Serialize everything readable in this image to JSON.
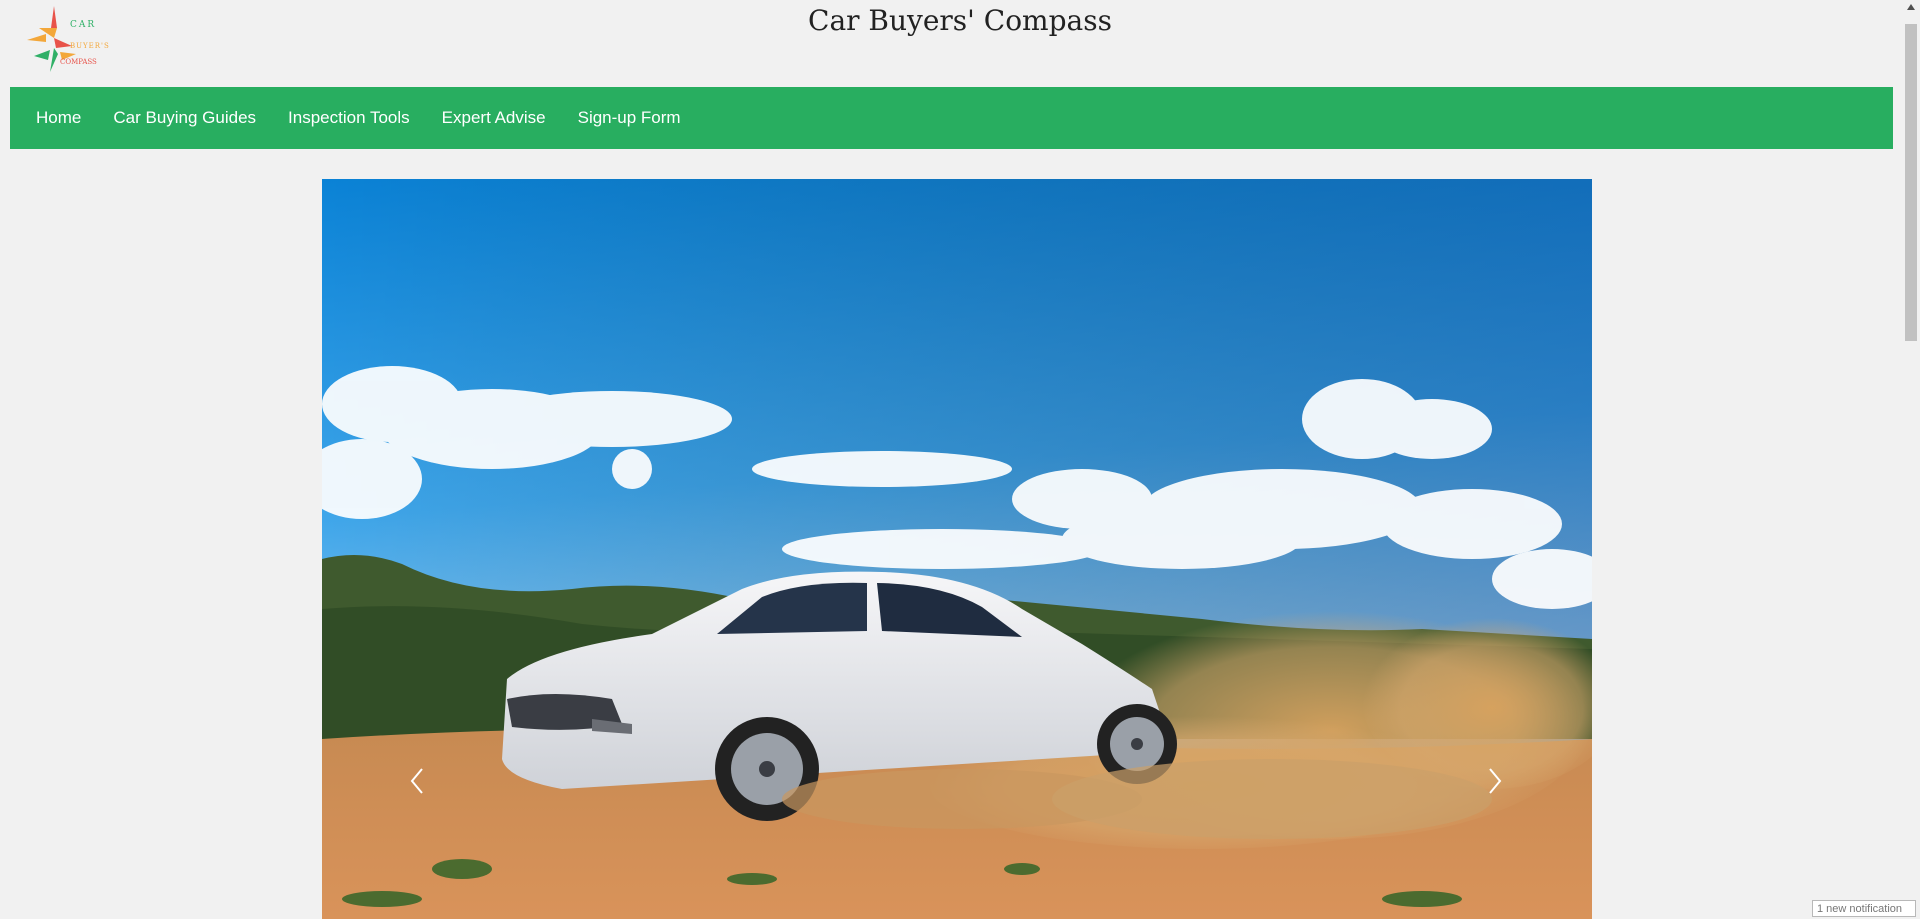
{
  "header": {
    "title": "Car Buyers' Compass",
    "logo": {
      "line1": "CAR",
      "line2": "BUYER'S",
      "line3": "COMPASS",
      "colors": [
        "#e8534a",
        "#f3a73a",
        "#2fb067"
      ]
    }
  },
  "nav": {
    "items": [
      {
        "label": "Home"
      },
      {
        "label": "Car Buying Guides"
      },
      {
        "label": "Inspection Tools"
      },
      {
        "label": "Expert Advise"
      },
      {
        "label": "Sign-up Form"
      }
    ],
    "color": "#28ae60"
  },
  "carousel": {
    "icons": {
      "prev": "chevron-left-icon",
      "next": "chevron-right-icon"
    }
  },
  "notification": {
    "text": "1 new notification"
  }
}
